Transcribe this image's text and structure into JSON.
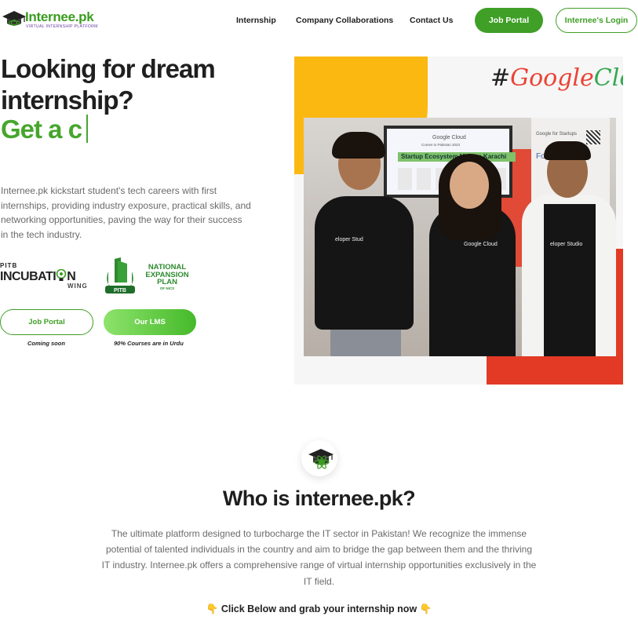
{
  "nav": {
    "logo_text": "Internee.pk",
    "logo_sub": "VIRTUAL INTERNSHIP PLATFORM",
    "links": [
      "Internship",
      "Company Collaborations",
      "Contact Us"
    ],
    "job_portal": "Job Portal",
    "login": "Internee's Login"
  },
  "hero": {
    "title": "Looking for dream internship?",
    "typed": "Get a c",
    "description": "Internee.pk kickstart student's tech careers with first internships, providing industry exposure, practical skills, and networking opportunities, paving the way for their success in the tech industry.",
    "partners": {
      "pitb_small": "PITB",
      "incubation": "INCUBATI",
      "incubation_end": "N",
      "wing": "WING",
      "pitb_mark": "PITB",
      "nep_line1": "NATIONAL",
      "nep_line2": "EXPANSION",
      "nep_line3": "PLAN",
      "nep_line4": "OF NICS"
    },
    "btn_job_portal": "Job Portal",
    "btn_lms": "Our LMS",
    "note_job_portal": "Coming soon",
    "note_lms": "90% Courses are in Urdu",
    "photo": {
      "hashtag": "#",
      "gc_word1": "Google",
      "gc_word2": "Cloud",
      "screen_title": "Google Cloud",
      "screen_sub": "Comes to Pakistan 2023",
      "screen_band": "Startup Ecosystem Meetup Karachi",
      "stand_title": "Google for Startups",
      "stand_big": "Fo inn infr",
      "shirt1": "eloper Stud",
      "shirt2": "Google Cloud",
      "shirt3": "eloper Studio"
    }
  },
  "who": {
    "title": "Who is internee.pk?",
    "description": "The ultimate platform designed to turbocharge the IT sector in Pakistan! We recognize the immense potential of talented individuals in the country and aim to bridge the gap between them and the thriving IT industry. Internee.pk offers a comprehensive range of virtual internship opportunities exclusively in the IT field.",
    "cta": "Click Below and grab your internship now",
    "cta_emoji": "👇"
  },
  "colors": {
    "brand_green": "#3f9f26",
    "accent_purple": "#6b3fa0",
    "deco_yellow": "#fbb811",
    "deco_red": "#e23a24"
  },
  "icons": [
    "graduation-cap-atom-icon",
    "pointing-down-icon"
  ]
}
